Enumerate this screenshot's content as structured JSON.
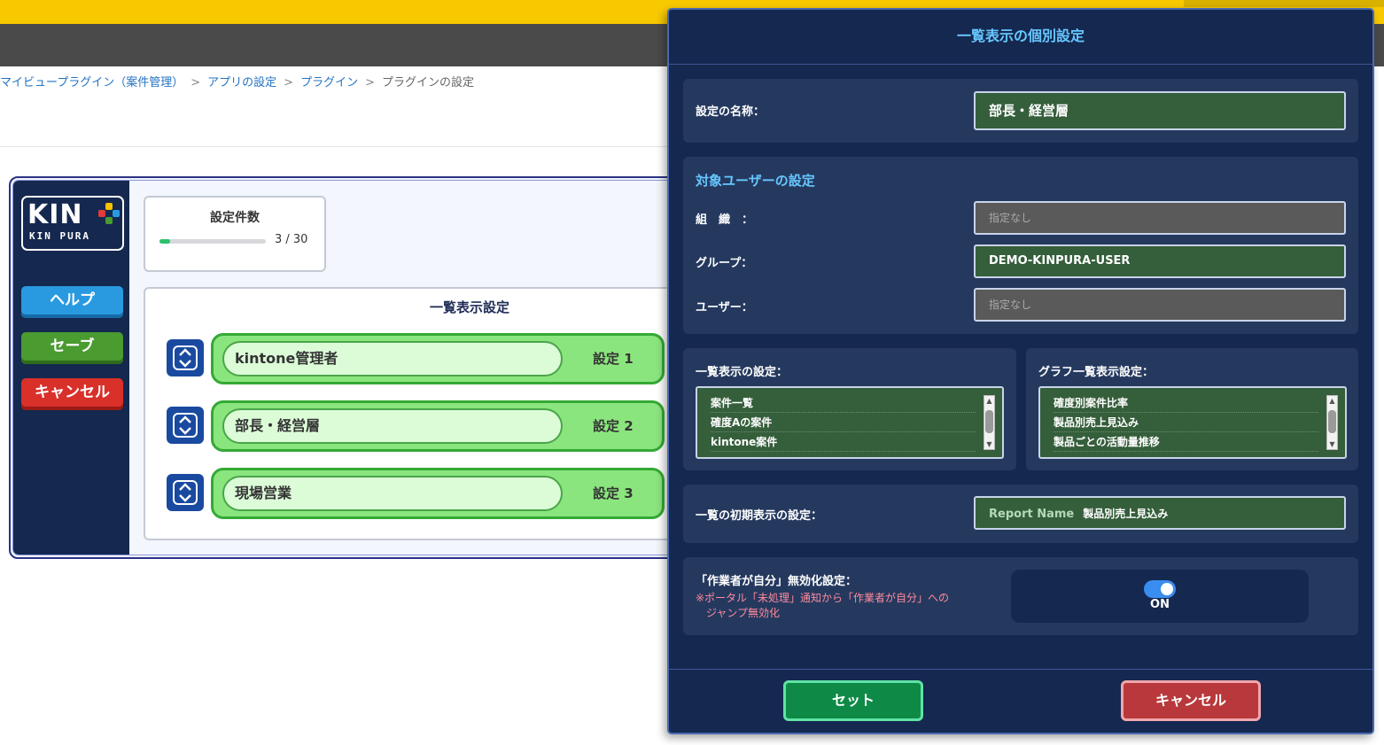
{
  "breadcrumb": {
    "items": [
      "マイビュープラグイン（案件管理）",
      "アプリの設定",
      "プラグイン"
    ],
    "separator": ">",
    "current": "プラグインの設定"
  },
  "logo": {
    "main": "KIN",
    "sub": "KIN PURA"
  },
  "sidebar": {
    "help": "ヘルプ",
    "save": "セーブ",
    "cancel": "キャンセル"
  },
  "count": {
    "title": "設定件数",
    "current": 3,
    "max": 30,
    "text": "3 / 30"
  },
  "list": {
    "title": "一覧表示設定",
    "rows": [
      {
        "name": "kintone管理者",
        "label": "設定 1"
      },
      {
        "name": "部長・経営層",
        "label": "設定 2"
      },
      {
        "name": "現場営業",
        "label": "設定 3"
      }
    ]
  },
  "modal": {
    "title": "一覧表示の個別設定",
    "name_label": "設定の名称：",
    "name_value": "部長・経営層",
    "target_title": "対象ユーザーの設定",
    "org_label": "組　織　：",
    "org_value": "指定なし",
    "group_label": "グループ：",
    "group_value": "DEMO-KINPURA-USER",
    "user_label": "ユーザー：",
    "user_value": "指定なし",
    "list_label": "一覧表示の設定：",
    "list_items": [
      "案件一覧",
      "確度Aの案件",
      "kintone案件"
    ],
    "graph_label": "グラフ一覧表示設定：",
    "graph_items": [
      "確度別案件比率",
      "製品別売上見込み",
      "製品ごとの活動量推移"
    ],
    "initial_label": "一覧の初期表示の設定：",
    "initial_key": "Report Name",
    "initial_value": "製品別売上見込み",
    "self_label": "「作業者が自分」無効化設定：",
    "self_note_1": "※ポータル「未処理」通知から「作業者が自分」への",
    "self_note_2": "ジャンプ無効化",
    "toggle_text": "ON",
    "set_button": "セット",
    "cancel_button": "キャンセル"
  },
  "colors": {
    "header_yellow": "#f9c900",
    "navy": "#15284f",
    "accent_blue": "#66c7ff",
    "field_green": "#355e3b",
    "row_green": "#8be57e"
  }
}
